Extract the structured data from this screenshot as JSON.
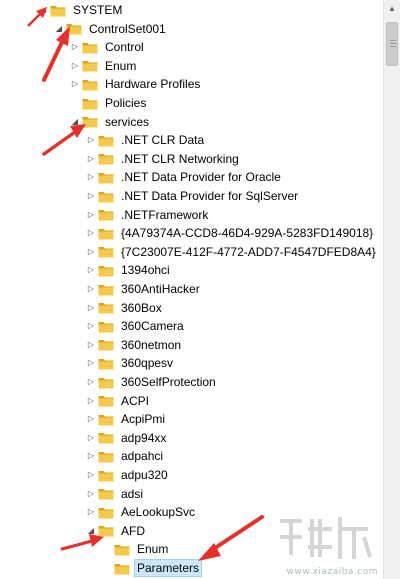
{
  "tree": [
    {
      "label": "SYSTEM",
      "depth": 0,
      "toggle": "expanded"
    },
    {
      "label": "ControlSet001",
      "depth": 1,
      "toggle": "expanded"
    },
    {
      "label": "Control",
      "depth": 2,
      "toggle": "collapsed"
    },
    {
      "label": "Enum",
      "depth": 2,
      "toggle": "collapsed"
    },
    {
      "label": "Hardware Profiles",
      "depth": 2,
      "toggle": "collapsed"
    },
    {
      "label": "Policies",
      "depth": 2,
      "toggle": "none"
    },
    {
      "label": "services",
      "depth": 2,
      "toggle": "expanded"
    },
    {
      "label": ".NET CLR Data",
      "depth": 3,
      "toggle": "collapsed"
    },
    {
      "label": ".NET CLR Networking",
      "depth": 3,
      "toggle": "collapsed"
    },
    {
      "label": ".NET Data Provider for Oracle",
      "depth": 3,
      "toggle": "collapsed"
    },
    {
      "label": ".NET Data Provider for SqlServer",
      "depth": 3,
      "toggle": "collapsed"
    },
    {
      "label": ".NETFramework",
      "depth": 3,
      "toggle": "collapsed"
    },
    {
      "label": "{4A79374A-CCD8-46D4-929A-5283FD149018}",
      "depth": 3,
      "toggle": "collapsed"
    },
    {
      "label": "{7C23007E-412F-4772-ADD7-F4547DFED8A4}",
      "depth": 3,
      "toggle": "collapsed"
    },
    {
      "label": "1394ohci",
      "depth": 3,
      "toggle": "collapsed"
    },
    {
      "label": "360AntiHacker",
      "depth": 3,
      "toggle": "collapsed"
    },
    {
      "label": "360Box",
      "depth": 3,
      "toggle": "collapsed"
    },
    {
      "label": "360Camera",
      "depth": 3,
      "toggle": "collapsed"
    },
    {
      "label": "360netmon",
      "depth": 3,
      "toggle": "collapsed"
    },
    {
      "label": "360qpesv",
      "depth": 3,
      "toggle": "collapsed"
    },
    {
      "label": "360SelfProtection",
      "depth": 3,
      "toggle": "collapsed"
    },
    {
      "label": "ACPI",
      "depth": 3,
      "toggle": "collapsed"
    },
    {
      "label": "AcpiPmi",
      "depth": 3,
      "toggle": "collapsed"
    },
    {
      "label": "adp94xx",
      "depth": 3,
      "toggle": "collapsed"
    },
    {
      "label": "adpahci",
      "depth": 3,
      "toggle": "collapsed"
    },
    {
      "label": "adpu320",
      "depth": 3,
      "toggle": "collapsed"
    },
    {
      "label": "adsi",
      "depth": 3,
      "toggle": "collapsed"
    },
    {
      "label": "AeLookupSvc",
      "depth": 3,
      "toggle": "collapsed"
    },
    {
      "label": "AFD",
      "depth": 3,
      "toggle": "expanded"
    },
    {
      "label": "Enum",
      "depth": 4,
      "toggle": "none"
    },
    {
      "label": "Parameters",
      "depth": 4,
      "toggle": "none",
      "selected": true
    }
  ],
  "colors": {
    "folder_fill": "#f5c94a",
    "folder_dark": "#d9a51c",
    "selection": "#cce8ff",
    "arrow": "#e8302a"
  },
  "icons": {
    "expanded": "expanded-triangle-icon",
    "collapsed": "collapsed-triangle-icon",
    "folder": "folder-icon"
  },
  "watermark": {
    "site": "www.xiazaiba.com"
  }
}
